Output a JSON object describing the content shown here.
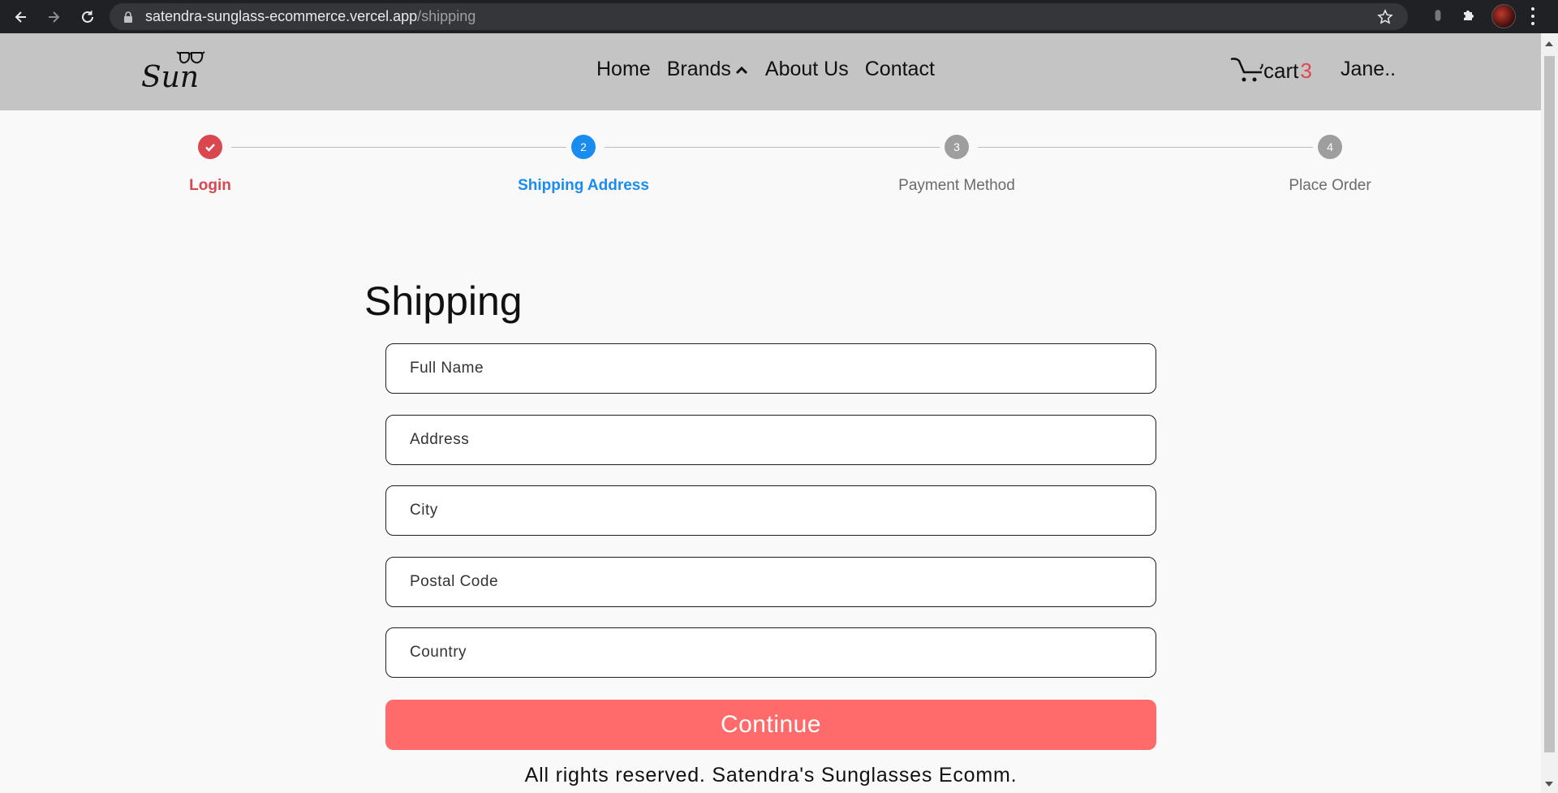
{
  "browser": {
    "url_host": "satendra-sunglass-ecommerce.vercel.app",
    "url_path": "/shipping"
  },
  "header": {
    "logo_text": "Sun",
    "nav": [
      "Home",
      "Brands",
      "About Us",
      "Contact"
    ],
    "cart_label": "cart",
    "cart_count": "3",
    "user_name": "Jane.."
  },
  "stepper": {
    "steps": [
      {
        "number": "",
        "label": "Login",
        "status": "completed",
        "color": "#d9474f"
      },
      {
        "number": "2",
        "label": "Shipping Address",
        "status": "active",
        "color": "#1a8cf0"
      },
      {
        "number": "3",
        "label": "Payment Method",
        "status": "pending",
        "color": "#9e9e9e"
      },
      {
        "number": "4",
        "label": "Place Order",
        "status": "pending",
        "color": "#9e9e9e"
      }
    ]
  },
  "form": {
    "title": "Shipping",
    "fields": {
      "full_name": {
        "placeholder": "Full Name",
        "value": ""
      },
      "address": {
        "placeholder": "Address",
        "value": ""
      },
      "city": {
        "placeholder": "City",
        "value": ""
      },
      "postal_code": {
        "placeholder": "Postal Code",
        "value": ""
      },
      "country": {
        "placeholder": "Country",
        "value": ""
      }
    },
    "continue_label": "Continue",
    "continue_color": "#ff6b6b"
  },
  "footer": {
    "text": "All rights reserved. Satendra's Sunglasses Ecomm."
  }
}
